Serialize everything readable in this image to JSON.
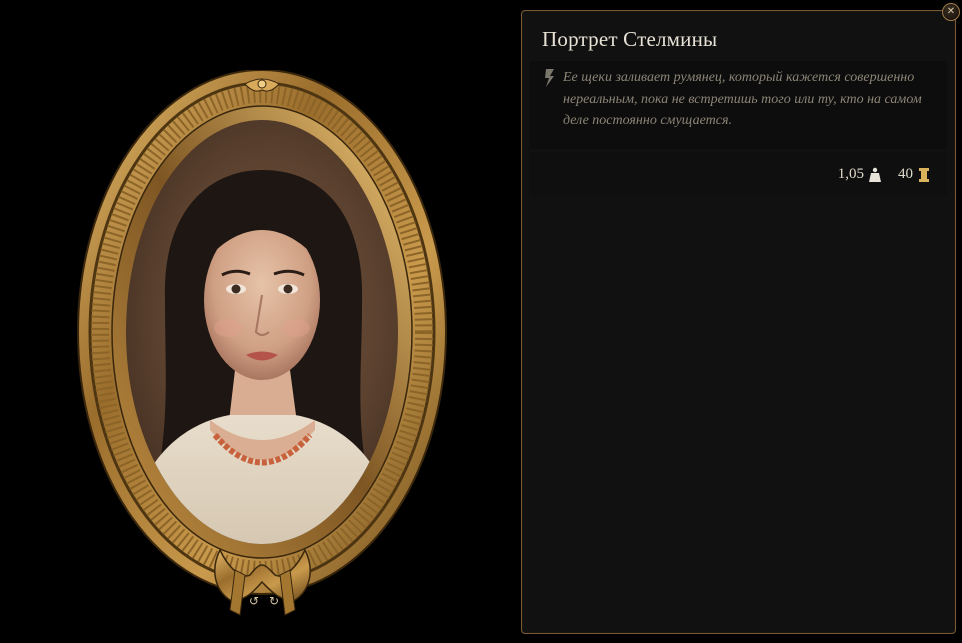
{
  "item": {
    "title": "Портрет Стелмины",
    "description": "Ее щеки заливает румянец, который кажется совершенно нереальным, пока не встретишь того или ту, кто на самом деле постоянно смущается.",
    "weight": "1,05",
    "value": "40"
  },
  "icons": {
    "close": "close-icon",
    "quote": "quill-icon",
    "weight": "weight-icon",
    "value": "gold-coin-icon",
    "rotate_left": "rotate-left-icon",
    "rotate_right": "rotate-right-icon"
  },
  "colors": {
    "frame_gold": "#b98a3e",
    "panel_border": "#7a5a35",
    "panel_bg": "#111111",
    "title_text": "#e8e2d6",
    "description_text": "#8c8577",
    "accent_gold": "#d9b25a"
  }
}
